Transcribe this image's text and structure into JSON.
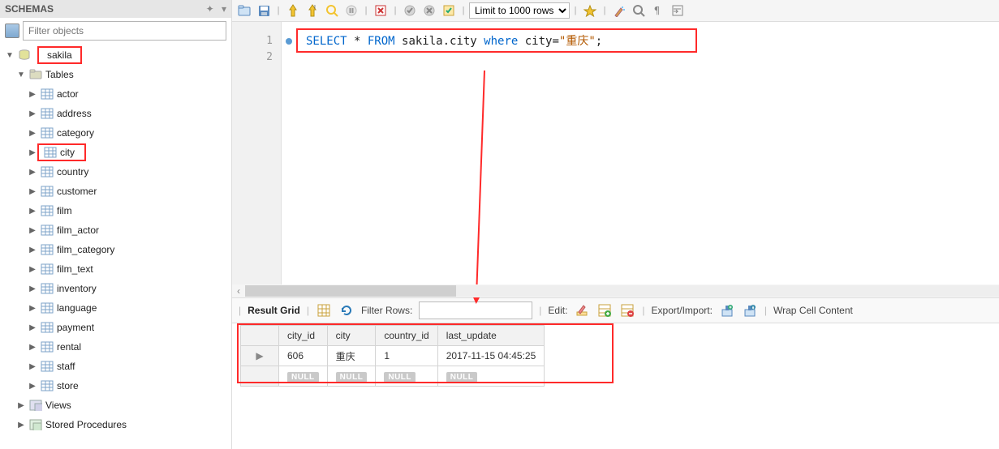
{
  "sidebar": {
    "title": "SCHEMAS",
    "filter_placeholder": "Filter objects",
    "database": "sakila",
    "tables_label": "Tables",
    "tables": [
      "actor",
      "address",
      "category",
      "city",
      "country",
      "customer",
      "film",
      "film_actor",
      "film_category",
      "film_text",
      "inventory",
      "language",
      "payment",
      "rental",
      "staff",
      "store"
    ],
    "highlight_table": "city",
    "views_label": "Views",
    "procedures_label": "Stored Procedures"
  },
  "toolbar": {
    "limit_options": [
      "Limit to 1000 rows"
    ],
    "limit_selected": "Limit to 1000 rows"
  },
  "sql": {
    "tokens": [
      {
        "t": "SELECT",
        "c": "kw"
      },
      {
        "t": " * ",
        "c": "txt"
      },
      {
        "t": "FROM",
        "c": "kw"
      },
      {
        "t": " sakila.city ",
        "c": "txt"
      },
      {
        "t": "where",
        "c": "kw"
      },
      {
        "t": " city=",
        "c": "txt"
      },
      {
        "t": "\"重庆\"",
        "c": "str"
      },
      {
        "t": ";",
        "c": "txt"
      }
    ],
    "line_numbers": [
      "1",
      "2"
    ]
  },
  "grid_toolbar": {
    "result_label": "Result Grid",
    "filter_label": "Filter Rows:",
    "filter_value": "",
    "edit_label": "Edit:",
    "export_label": "Export/Import:",
    "wrap_label": "Wrap Cell Content"
  },
  "result": {
    "headers": [
      "city_id",
      "city",
      "country_id",
      "last_update"
    ],
    "rows": [
      {
        "cells": [
          "606",
          "重庆",
          "1",
          "2017-11-15 04:45:25"
        ],
        "null": false
      },
      {
        "cells": [
          "NULL",
          "NULL",
          "NULL",
          "NULL"
        ],
        "null": true
      }
    ],
    "null_label": "NULL"
  }
}
